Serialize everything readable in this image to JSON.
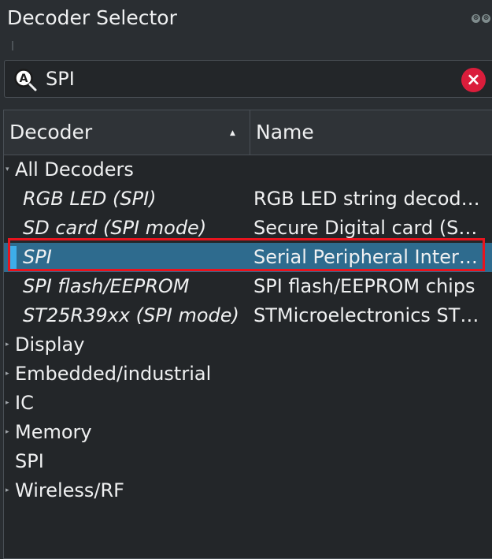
{
  "window": {
    "title": "Decoder Selector"
  },
  "search": {
    "value": "SPI",
    "icon": "search-icon",
    "clear_icon": "clear-icon"
  },
  "table": {
    "headers": {
      "decoder": "Decoder",
      "name": "Name"
    },
    "sort": "ascending"
  },
  "tree": {
    "all_decoders": "All Decoders",
    "children": [
      {
        "decoder": "RGB LED (SPI)",
        "name": "RGB LED string decod…"
      },
      {
        "decoder": "SD card (SPI mode)",
        "name": "Secure Digital card (S…"
      },
      {
        "decoder": "SPI",
        "name": "Serial Peripheral Inter…",
        "selected": true
      },
      {
        "decoder": "SPI flash/EEPROM",
        "name": "SPI flash/EEPROM chips"
      },
      {
        "decoder": "ST25R39xx (SPI mode)",
        "name": "STMicroelectronics ST…"
      }
    ],
    "categories": [
      "Display",
      "Embedded/industrial",
      "IC",
      "Memory",
      "SPI",
      "Wireless/RF"
    ]
  },
  "colors": {
    "accent": "#3daee9",
    "selection": "#2e6b8e",
    "highlight": "#e8141e",
    "clear": "#da1d3b"
  }
}
